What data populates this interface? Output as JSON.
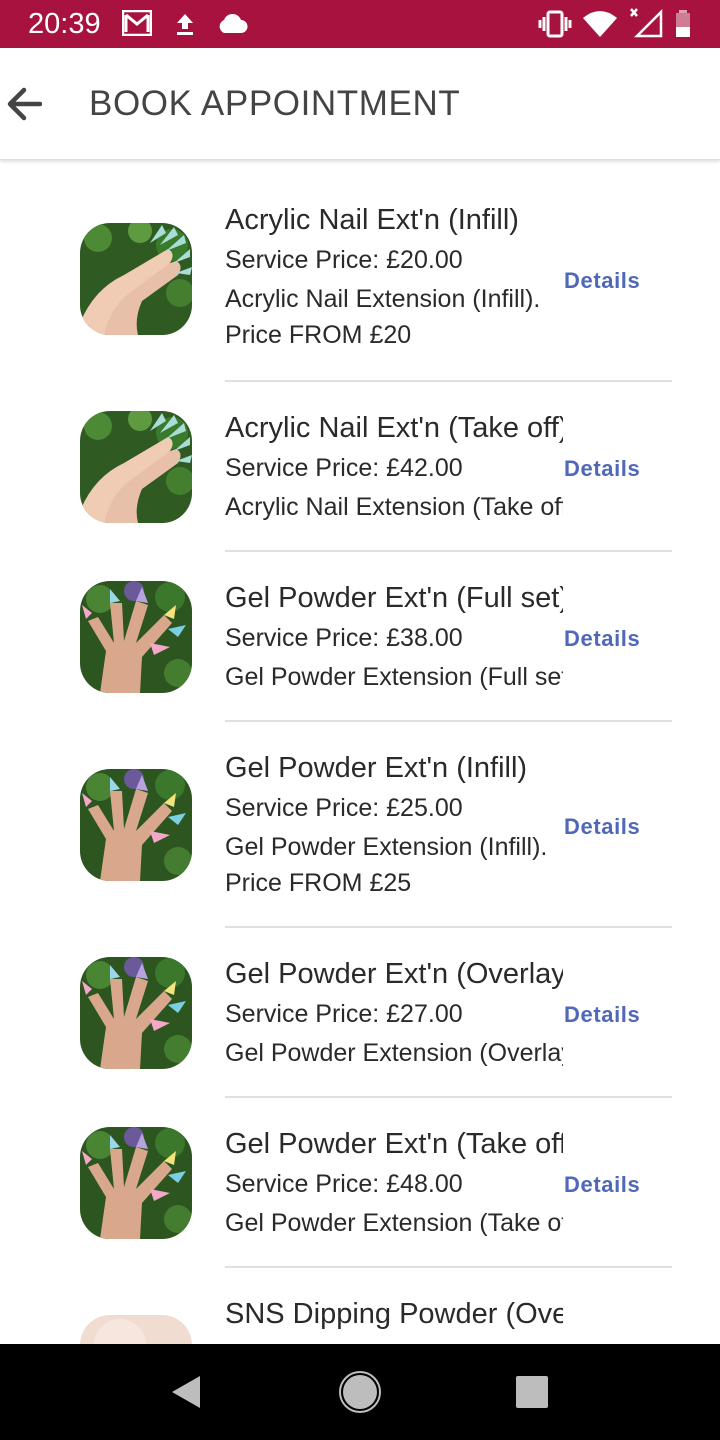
{
  "status_bar": {
    "time": "20:39",
    "icons": [
      "gmail-icon",
      "upload-icon",
      "cloud-icon",
      "vibrate-icon",
      "wifi-icon",
      "signal-icon",
      "battery-icon"
    ],
    "background_color": "#A8123E"
  },
  "app_bar": {
    "title": "BOOK APPOINTMENT",
    "back_icon": "arrow-left-icon"
  },
  "services": [
    {
      "title": "Acrylic Nail Ext'n (Infill)",
      "price": "Service Price: £20.00",
      "description_lines": [
        "Acrylic Nail Extension (Infill).",
        "Price FROM £20"
      ],
      "details_label": "Details",
      "thumbnail": "acrylic-nails-thumbnail"
    },
    {
      "title": "Acrylic Nail Ext'n (Take off)",
      "price": "Service Price: £42.00",
      "description_lines": [
        "Acrylic Nail Extension (Take off)"
      ],
      "details_label": "Details",
      "thumbnail": "acrylic-nails-thumbnail"
    },
    {
      "title": "Gel Powder Ext'n (Full set)",
      "price": "Service Price: £38.00",
      "description_lines": [
        "Gel Powder Extension (Full set)"
      ],
      "details_label": "Details",
      "thumbnail": "gel-powder-nails-thumbnail"
    },
    {
      "title": "Gel Powder Ext'n (Infill)",
      "price": "Service Price: £25.00",
      "description_lines": [
        "Gel Powder Extension (Infill).",
        "Price FROM £25"
      ],
      "details_label": "Details",
      "thumbnail": "gel-powder-nails-thumbnail"
    },
    {
      "title": "Gel Powder Ext'n (Overlay)",
      "price": "Service Price: £27.00",
      "description_lines": [
        "Gel Powder Extension (Overlay)"
      ],
      "details_label": "Details",
      "thumbnail": "gel-powder-nails-thumbnail"
    },
    {
      "title": "Gel Powder Ext'n (Take off)",
      "price": "Service Price: £48.00",
      "description_lines": [
        "Gel Powder Extension (Take off)"
      ],
      "details_label": "Details",
      "thumbnail": "gel-powder-nails-thumbnail"
    },
    {
      "title": "SNS Dipping Powder (Overlay)",
      "thumbnail": "sns-nails-thumbnail"
    }
  ],
  "colors": {
    "accent": "#A8123E",
    "details_link": "#5068B8",
    "text": "#2a2a2a"
  },
  "nav_bar": {
    "icons": [
      "back-triangle-icon",
      "home-circle-icon",
      "recents-square-icon"
    ]
  }
}
